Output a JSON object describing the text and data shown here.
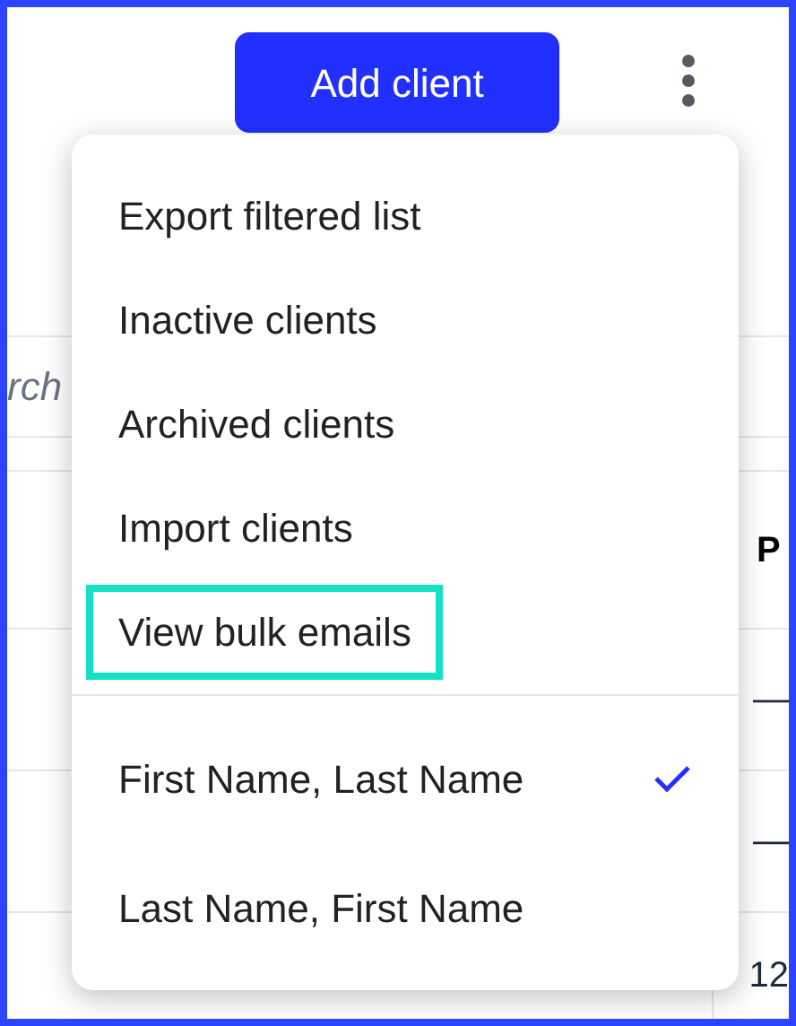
{
  "header": {
    "add_button": "Add client"
  },
  "menu": {
    "actions": [
      {
        "label": "Export filtered list",
        "highlighted": false
      },
      {
        "label": "Inactive clients",
        "highlighted": false
      },
      {
        "label": "Archived clients",
        "highlighted": false
      },
      {
        "label": "Import clients",
        "highlighted": false
      },
      {
        "label": "View bulk emails",
        "highlighted": true
      }
    ],
    "sort_options": [
      {
        "label": "First Name, Last Name",
        "selected": true
      },
      {
        "label": "Last Name, First Name",
        "selected": false
      }
    ]
  },
  "table": {
    "search_placeholder": "rch",
    "column_header": "P",
    "cells": [
      "—",
      "—",
      "12"
    ]
  }
}
